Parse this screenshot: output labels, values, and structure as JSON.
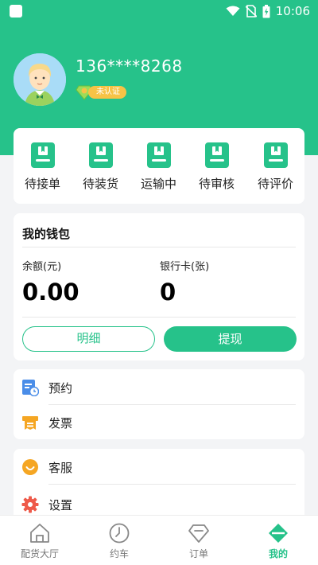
{
  "status_bar": {
    "time": "10:06"
  },
  "profile": {
    "phone": "136****8268",
    "verify_badge": "未认证"
  },
  "orders": {
    "items": [
      {
        "label": "待接单"
      },
      {
        "label": "待装货"
      },
      {
        "label": "运输中"
      },
      {
        "label": "待审核"
      },
      {
        "label": "待评价"
      }
    ]
  },
  "wallet": {
    "title": "我的钱包",
    "balance_label": "余额(元)",
    "balance_value": "0.00",
    "card_label": "银行卡(张)",
    "card_value": "0",
    "detail_button": "明细",
    "withdraw_button": "提现"
  },
  "menu": {
    "booking": "预约",
    "invoice": "发票",
    "service": "客服",
    "settings": "设置"
  },
  "nav": {
    "items": [
      {
        "label": "配货大厅"
      },
      {
        "label": "约车"
      },
      {
        "label": "订单"
      },
      {
        "label": "我的"
      }
    ]
  },
  "colors": {
    "primary": "#26c28a",
    "badge": "#f6c346",
    "text": "#222222"
  }
}
